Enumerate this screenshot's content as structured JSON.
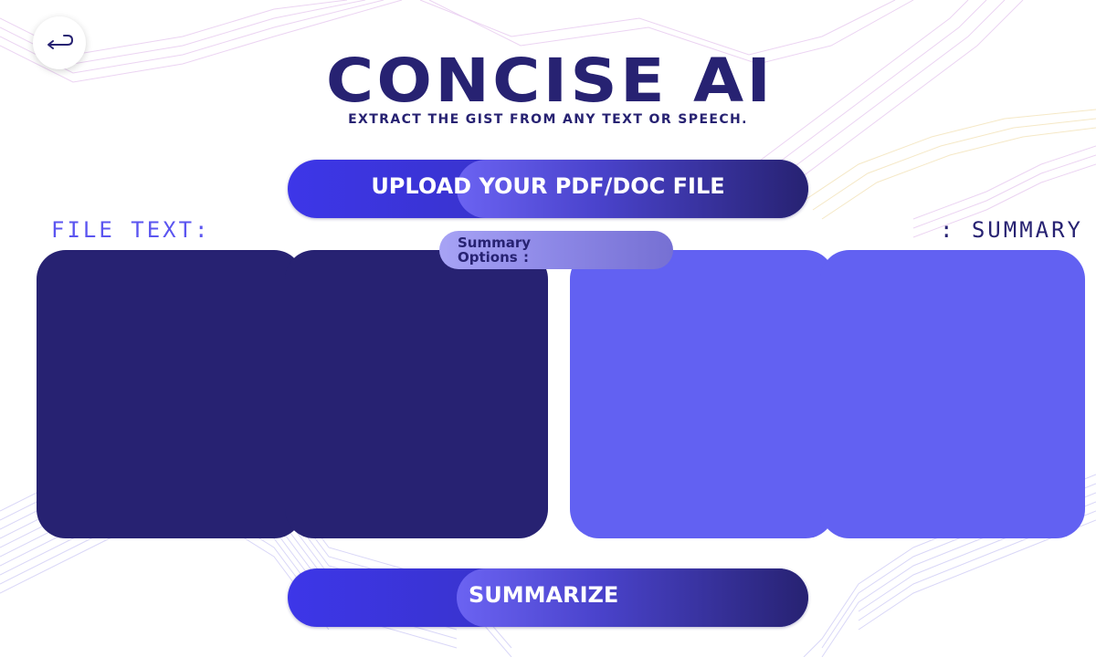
{
  "header": {
    "title": "CONCISE AI",
    "subtitle": "EXTRACT THE GIST FROM ANY TEXT OR SPEECH."
  },
  "back_button": {
    "icon": "return-arrow-icon"
  },
  "upload": {
    "label": "UPLOAD YOUR PDF/DOC FILE"
  },
  "file_text": {
    "label": "FILE TEXT:"
  },
  "summary": {
    "label": ": SUMMARY"
  },
  "options": {
    "label": "Summary Options",
    "colon": ":"
  },
  "summarize": {
    "label": "SUMMARIZE"
  },
  "colors": {
    "dark_navy": "#272272",
    "accent_indigo": "#6261f2",
    "button_blue": "#3d36e8",
    "file_label": "#5b55f0"
  }
}
